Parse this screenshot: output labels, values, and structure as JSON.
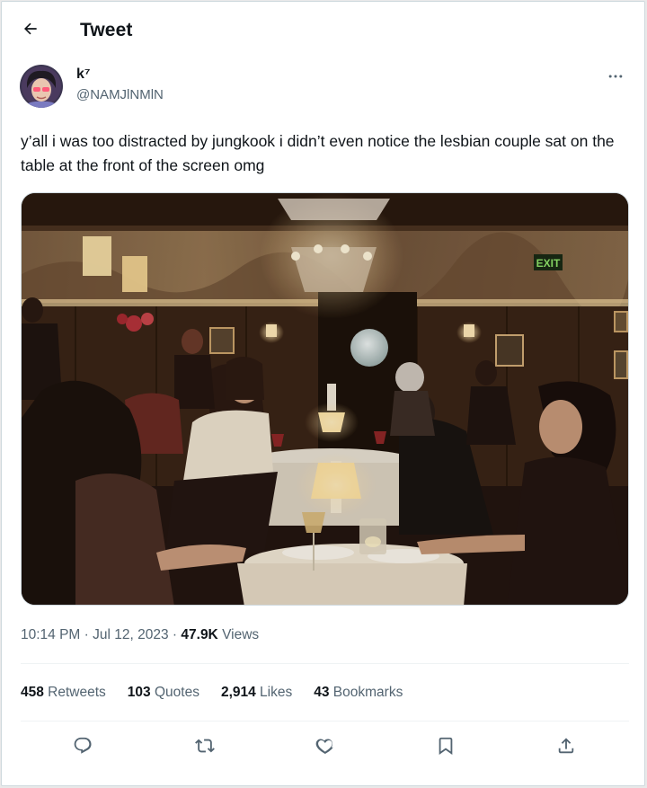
{
  "header": {
    "title": "Tweet"
  },
  "author": {
    "display_name": "k⁷",
    "handle": "@NAMJlNMlN"
  },
  "tweet": {
    "text": "y’all i was too distracted by jungkook i didn’t even notice the lesbian couple sat on the table at the front of the screen omg"
  },
  "media": {
    "sign_text": "EXIT"
  },
  "meta": {
    "time": "10:14 PM",
    "sep1": " · ",
    "date": "Jul 12, 2023",
    "sep2": " · ",
    "views_count": "47.9K",
    "views_label": " Views"
  },
  "stats": [
    {
      "count": "458",
      "label": " Retweets"
    },
    {
      "count": "103",
      "label": " Quotes"
    },
    {
      "count": "2,914",
      "label": " Likes"
    },
    {
      "count": "43",
      "label": " Bookmarks"
    }
  ],
  "icons": {
    "back": "arrow-left-icon",
    "more": "more-horizontal-icon",
    "reply": "reply-icon",
    "retweet": "retweet-icon",
    "like": "heart-icon",
    "bookmark": "bookmark-icon",
    "share": "share-icon"
  },
  "colors": {
    "text": "#0f1419",
    "secondary": "#536471",
    "border": "#cfd9de",
    "divider": "#eff3f4"
  }
}
